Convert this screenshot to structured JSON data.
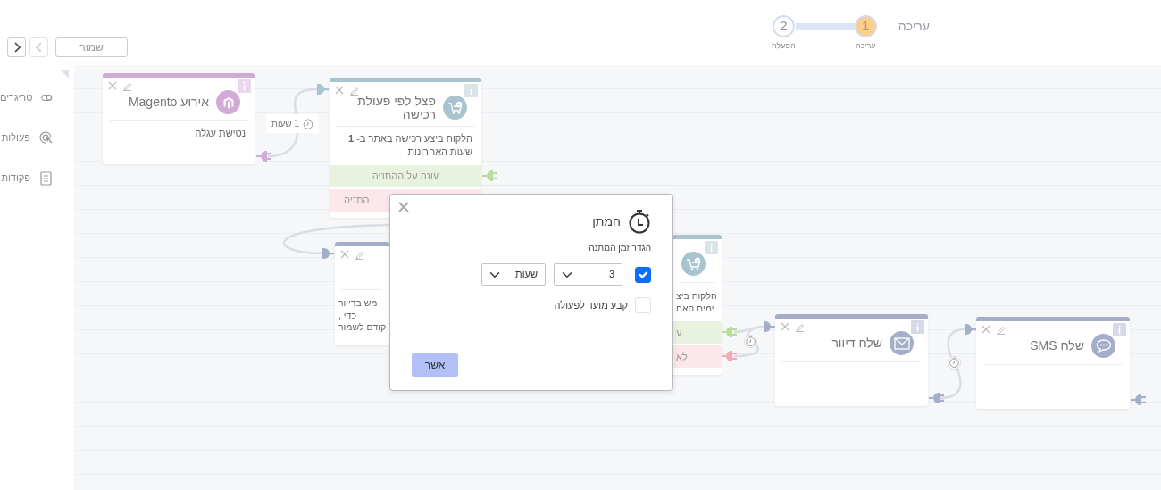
{
  "header": {
    "title": "עריכה",
    "steps": [
      {
        "number": "1",
        "label": "עריכה",
        "selected": true
      },
      {
        "number": "2",
        "label": "הפעלה",
        "selected": false
      }
    ]
  },
  "toolbar": {
    "save": "שמור",
    "next_disabled": false,
    "prev_disabled": true
  },
  "sidebar": {
    "items": [
      {
        "label": "טריגרים"
      },
      {
        "label": "פעולות"
      },
      {
        "label": "פקודות"
      }
    ]
  },
  "nodes": [
    {
      "kind": "full",
      "title": "פצל לפי פעולת רכישה",
      "description": "הלקוח ביצע רכישה באתר ב- **1** שעות האחרונות",
      "color": "#a9c3cf",
      "outcomes": [
        {
          "kind": "yes",
          "text": "עונה על ההתניה"
        },
        {
          "kind": "no",
          "text": "התניה"
        }
      ]
    },
    {
      "kind": "full",
      "title": "אירוע Magento",
      "description": "נטישת עגלה",
      "color": "#d1abd5"
    },
    {
      "kind": "cut_left",
      "description": "הלקוח ביצ\nימים האח",
      "color": "#a9c3cf",
      "outcomes": [
        {
          "kind": "yes",
          "text": "ע"
        },
        {
          "kind": "no",
          "text": "לא"
        }
      ]
    },
    {
      "kind": "cut_right",
      "description": "מש בדיוור\nכדי ,\nקודם לשמור",
      "color": "#a4aec8"
    },
    {
      "kind": "full",
      "title": "שלח SMS",
      "color": "#a4aec8"
    },
    {
      "kind": "full",
      "title": "שלח דיוור",
      "color": "#a4aec8"
    }
  ],
  "wait_labels": [
    "1 שעות"
  ],
  "modal": {
    "title": "המתן",
    "label": "הגדר זמן המתנה",
    "wait_checked": true,
    "amount": "3",
    "unit": "שעות",
    "schedule_label": "קבע מועד לפעולה",
    "schedule_checked": false,
    "confirm": "אשר"
  }
}
